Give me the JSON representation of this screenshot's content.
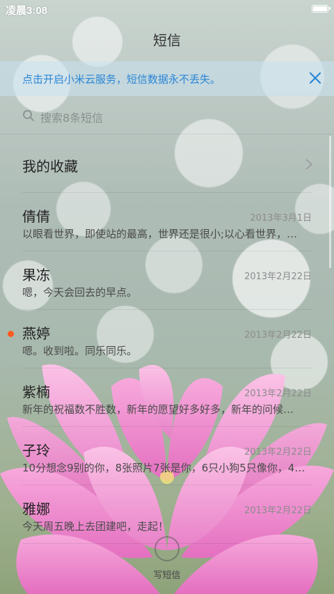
{
  "status_bar": {
    "time": "凌晨3:08"
  },
  "header": {
    "title": "短信"
  },
  "banner": {
    "text": "点击开启小米云服务，短信数据永不丢失。",
    "accent_color": "#2a86d6"
  },
  "search": {
    "placeholder": "搜索8条短信"
  },
  "favorites": {
    "label": "我的收藏"
  },
  "conversations": [
    {
      "name": "倩倩",
      "date": "2013年3月1日",
      "preview": "以眼看世界，即使站的最高，世界还是很小;以心看世界，…",
      "unread": false
    },
    {
      "name": "果冻",
      "date": "2013年2月22日",
      "preview": "嗯，今天会回去的早点。",
      "unread": false
    },
    {
      "name": "燕婷",
      "date": "2013年2月22日",
      "preview": "嗯。收到啦。同乐同乐。",
      "unread": true
    },
    {
      "name": "紫楠",
      "date": "2013年2月22日",
      "preview": "新年的祝福数不胜数，新年的愿望好多好多，新年的问候…",
      "unread": false
    },
    {
      "name": "子玲",
      "date": "2013年2月22日",
      "preview": "10分想念9别的你，8张照片7张是你，6只小狗5只像你，4…",
      "unread": false
    },
    {
      "name": "雅娜",
      "date": "2013年2月22日",
      "preview": "今天周五晚上去团建吧，走起！",
      "unread": false
    }
  ],
  "compose": {
    "label": "写短信"
  },
  "colors": {
    "unread_dot": "#ff5a1f"
  }
}
